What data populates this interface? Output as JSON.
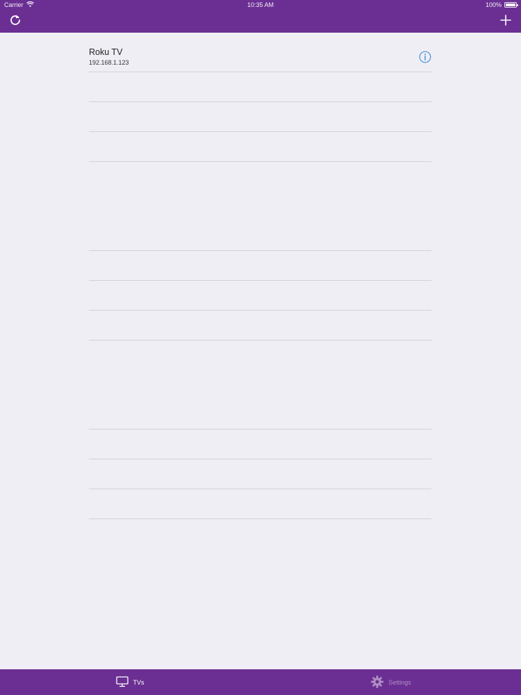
{
  "status_bar": {
    "carrier": "Carrier",
    "time": "10:35 AM",
    "battery": "100%",
    "battery_level": 1.0
  },
  "nav": {
    "refresh_icon": "refresh-icon",
    "add_icon": "plus-icon"
  },
  "devices": [
    {
      "name": "Roku TV",
      "ip": "192.168.1.123",
      "info_icon": "info-icon"
    }
  ],
  "tabs": [
    {
      "label": "TVs",
      "icon": "tv-icon",
      "active": true
    },
    {
      "label": "Settings",
      "icon": "gear-icon",
      "active": false
    }
  ],
  "colors": {
    "brand": "#6b2f93",
    "background": "#efeef4",
    "separator": "#d2d1d6",
    "info_accent": "#4a90d9"
  }
}
